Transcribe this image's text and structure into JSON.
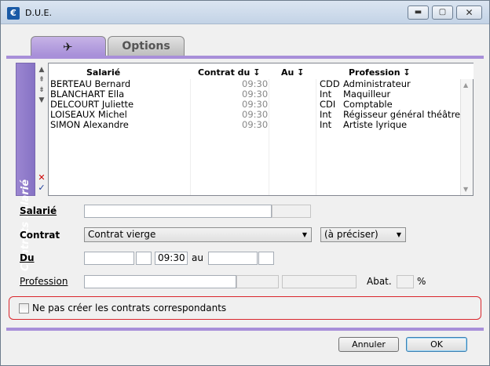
{
  "window": {
    "title": "D.U.E.",
    "app_icon": "€",
    "min_icon": "▬",
    "max_icon": "▢",
    "close_icon": "✕"
  },
  "tabs": [
    {
      "label": "",
      "icon": "plane-icon",
      "active": true
    },
    {
      "label": "Options",
      "active": false
    }
  ],
  "sidebar": {
    "label": "Contrats salarié"
  },
  "list": {
    "columns": [
      "Salarié",
      "Contrat du ↧",
      "Au ↧",
      "Profession ↧"
    ],
    "rows": [
      {
        "name": "BERTEAU Bernard",
        "time": "09:30",
        "type": "CDD",
        "profession": "Administrateur"
      },
      {
        "name": "BLANCHART Ella",
        "time": "09:30",
        "type": "Int",
        "profession": "Maquilleur"
      },
      {
        "name": "DELCOURT Juliette",
        "time": "09:30",
        "type": "CDI",
        "profession": "Comptable"
      },
      {
        "name": "LOISEAUX Michel",
        "time": "09:30",
        "type": "Int",
        "profession": "Régisseur général théâtre"
      },
      {
        "name": "SIMON Alexandre",
        "time": "09:30",
        "type": "Int",
        "profession": "Artiste lyrique"
      }
    ]
  },
  "form": {
    "salarie_label": "Salarié",
    "contrat_label": "Contrat",
    "contrat_value": "Contrat vierge",
    "contrat_type_value": "(à préciser)",
    "du_label": "Du",
    "du_time": "09:30",
    "au_label": "au",
    "profession_label": "Profession",
    "abat_label": "Abat.",
    "percent": "%"
  },
  "checkbox": {
    "label": "Ne pas créer les contrats correspondants",
    "checked": false
  },
  "buttons": {
    "cancel": "Annuler",
    "ok": "OK"
  },
  "colors": {
    "accent": "#a88fd9",
    "highlight": "#d9262c"
  }
}
